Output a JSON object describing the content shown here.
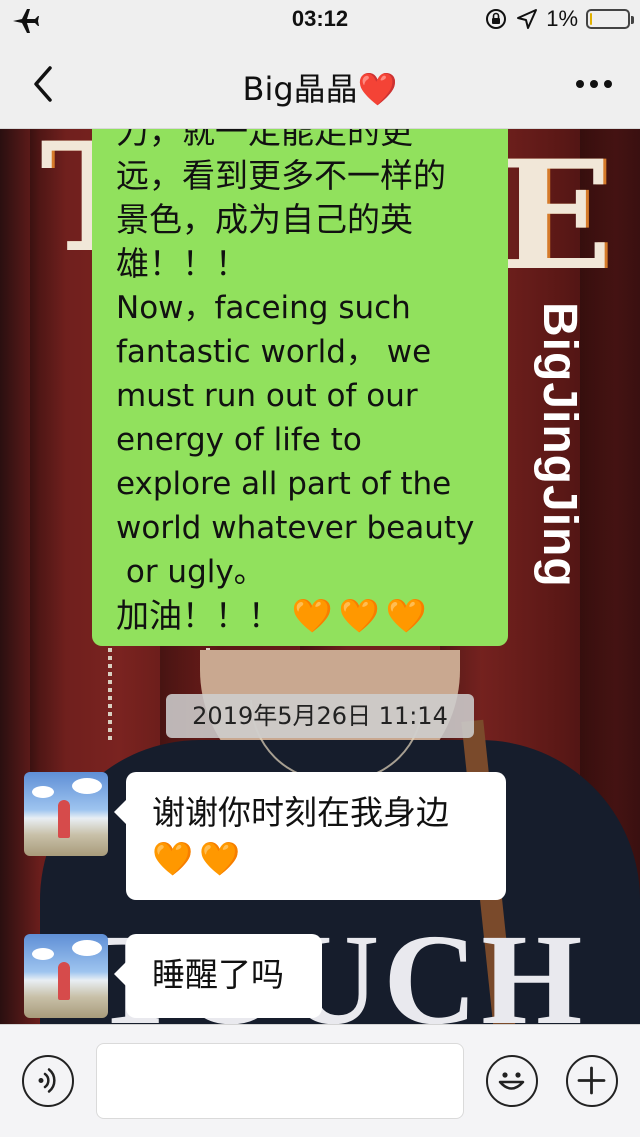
{
  "status_bar": {
    "time": "03:12",
    "battery_text": "1%",
    "battery_fraction": 0.05,
    "icons": [
      "airplane-icon",
      "orientation-lock-icon",
      "location-arrow-icon",
      "battery-icon"
    ]
  },
  "nav": {
    "title": "Big晶晶",
    "title_emoji": "❤️",
    "back_icon": "chevron-left-icon",
    "more_icon": "more-dots-icon"
  },
  "background": {
    "vertical_text": "BigJingJing",
    "shirt_print": "TOUCH"
  },
  "messages": {
    "sent_long": {
      "lines": [
        "力，就一定能走的更",
        "远，看到更多不一样的",
        "景色，成为自己的英",
        "雄！！！",
        "Now，faceing such",
        "fantastic world， we",
        "must run out of our",
        "energy of life to",
        "explore all part of the",
        "world whatever beauty",
        " or ugly。",
        "加油！！！"
      ],
      "hearts": "🧡🧡🧡",
      "bubble_color": "#91e15d"
    },
    "timestamp": "2019年5月26日 11:14",
    "received_1": {
      "line1": "谢谢你时刻在我身边",
      "hearts": "🧡🧡"
    },
    "received_2": {
      "text": "睡醒了吗"
    }
  },
  "input_bar": {
    "voice_icon": "voice-icon",
    "emoji_icon": "emoji-icon",
    "add_icon": "plus-icon",
    "input_value": ""
  }
}
